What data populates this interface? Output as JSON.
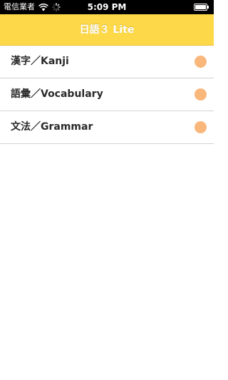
{
  "status_bar": {
    "carrier": "電信業者",
    "time": "5:09 PM",
    "wifi_icon": "wifi-icon",
    "activity_icon": "spinner-icon",
    "battery_icon": "battery-icon"
  },
  "nav": {
    "title": "日語３ Lite",
    "background": "#fdd848"
  },
  "list": {
    "items": [
      {
        "label": "漢字／Kanji",
        "dot_color": "#f9b77c"
      },
      {
        "label": "語彙／Vocabulary",
        "dot_color": "#f9b77c"
      },
      {
        "label": "文法／Grammar",
        "dot_color": "#f9b77c"
      }
    ]
  }
}
